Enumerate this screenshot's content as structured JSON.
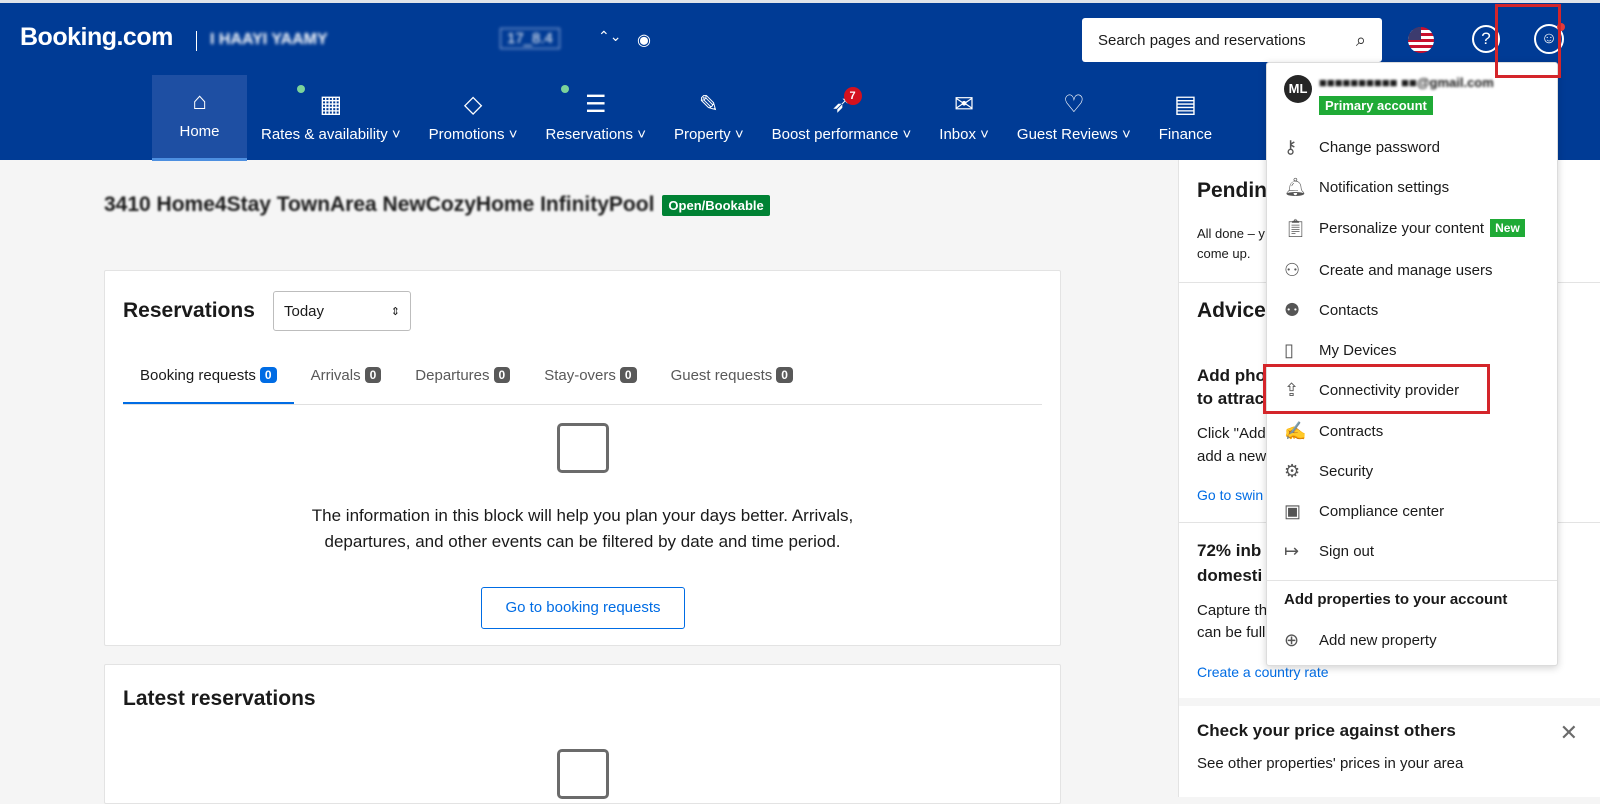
{
  "header": {
    "logo": "Booking.com",
    "account_name": "I HAAYI YAAMY",
    "account_id": "17_8.4",
    "search_placeholder": "Search pages and reservations"
  },
  "nav": [
    {
      "label": "Home",
      "icon": "home-icon"
    },
    {
      "label": "Rates & availability",
      "icon": "calendar-icon"
    },
    {
      "label": "Promotions",
      "icon": "tag-icon"
    },
    {
      "label": "Reservations",
      "icon": "list-icon"
    },
    {
      "label": "Property",
      "icon": "pencil-icon"
    },
    {
      "label": "Boost performance",
      "icon": "rocket-icon",
      "badge": "7"
    },
    {
      "label": "Inbox",
      "icon": "mail-icon"
    },
    {
      "label": "Guest Reviews",
      "icon": "heart-icon"
    },
    {
      "label": "Finance",
      "icon": "document-icon"
    }
  ],
  "property": {
    "title": "3410 Home4Stay TownArea NewCozyHome InfinityPool",
    "status": "Open/Bookable"
  },
  "reservations": {
    "title": "Reservations",
    "period": "Today",
    "tabs": [
      {
        "label": "Booking requests",
        "count": "0"
      },
      {
        "label": "Arrivals",
        "count": "0"
      },
      {
        "label": "Departures",
        "count": "0"
      },
      {
        "label": "Stay-overs",
        "count": "0"
      },
      {
        "label": "Guest requests",
        "count": "0"
      }
    ],
    "info_line1": "The information in this block will help you plan your days better. Arrivals,",
    "info_line2": "departures, and other events can be filtered by date and time period.",
    "button": "Go to booking requests"
  },
  "latest": {
    "title": "Latest reservations"
  },
  "sidebar": {
    "pending_title": "Pendin",
    "pending_text1": "All done – y",
    "pending_text2": "come up.",
    "advice_title": "Advice",
    "tip1_title1": "Add pho",
    "tip1_title2": "to attrac",
    "tip1_text1": "Click \"Add",
    "tip1_text2": "add a new",
    "tip1_link": "Go to swin",
    "tip2_title1": "72% inb",
    "tip2_title2": "domesti",
    "tip2_text1": "Capture th",
    "tip2_text2": "can be full",
    "tip2_link": "Create a country rate",
    "price_title": "Check your price against others",
    "price_text": "See other properties' prices in your area"
  },
  "menu": {
    "avatar": "ML",
    "email": "■■■■■■■■■■ ■■@gmail.com",
    "primary": "Primary account",
    "items": [
      {
        "label": "Change password",
        "icon": "key-icon"
      },
      {
        "label": "Notification settings",
        "icon": "bell-icon"
      },
      {
        "label": "Personalize your content",
        "icon": "clipboard-heart-icon",
        "badge": "New"
      },
      {
        "label": "Create and manage users",
        "icon": "user-add-icon"
      },
      {
        "label": "Contacts",
        "icon": "contacts-icon"
      },
      {
        "label": "My Devices",
        "icon": "device-icon"
      },
      {
        "label": "Connectivity provider",
        "icon": "share-icon"
      },
      {
        "label": "Contracts",
        "icon": "contract-icon"
      },
      {
        "label": "Security",
        "icon": "gear-icon"
      },
      {
        "label": "Compliance center",
        "icon": "compliance-icon"
      },
      {
        "label": "Sign out",
        "icon": "sign-out-icon"
      }
    ],
    "add_heading": "Add properties to your account",
    "add_item": "Add new property"
  }
}
